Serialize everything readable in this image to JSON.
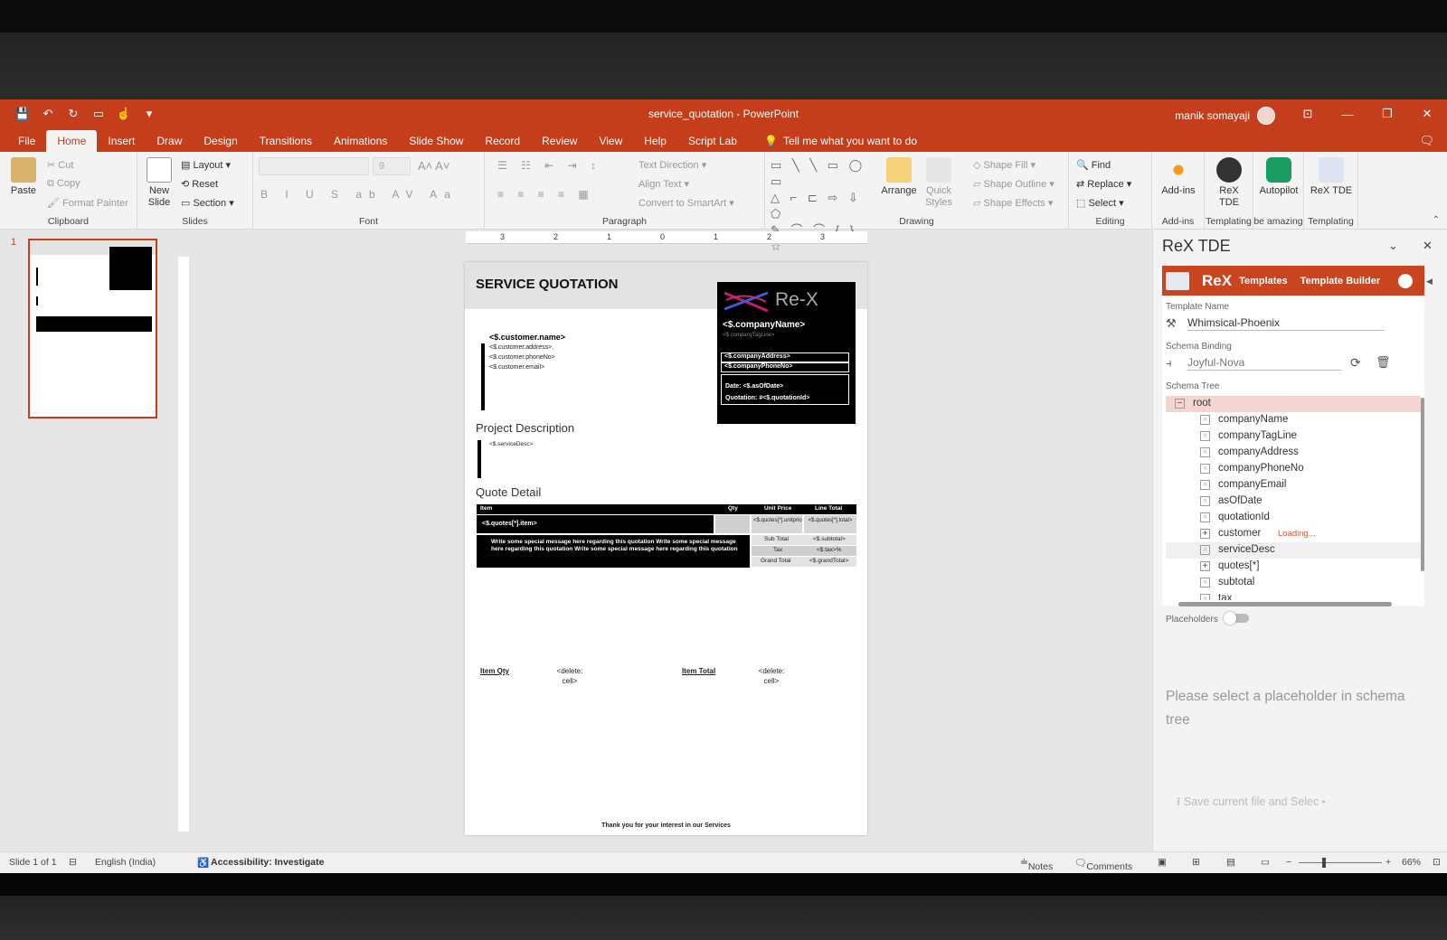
{
  "window": {
    "title": "service_quotation  -  PowerPoint",
    "user": "manik somayaji"
  },
  "tabs": [
    "File",
    "Home",
    "Insert",
    "Draw",
    "Design",
    "Transitions",
    "Animations",
    "Slide Show",
    "Record",
    "Review",
    "View",
    "Help",
    "Script Lab"
  ],
  "tell_me": "Tell me what you want to do",
  "clipboard": {
    "paste": "Paste",
    "cut": "Cut",
    "copy": "Copy",
    "format_painter": "Format Painter",
    "label": "Clipboard"
  },
  "slides_group": {
    "new_slide": "New Slide",
    "layout": "Layout",
    "reset": "Reset",
    "section": "Section",
    "label": "Slides"
  },
  "font_group": {
    "size": "9",
    "label": "Font"
  },
  "paragraph_group": {
    "text_direction": "Text Direction",
    "align_text": "Align Text",
    "smartart": "Convert to SmartArt",
    "label": "Paragraph"
  },
  "drawing_group": {
    "arrange": "Arrange",
    "quick_styles": "Quick Styles",
    "fill": "Shape Fill",
    "outline": "Shape Outline",
    "effects": "Shape Effects",
    "label": "Drawing"
  },
  "editing_group": {
    "find": "Find",
    "replace": "Replace",
    "select": "Select",
    "label": "Editing"
  },
  "addins_group": {
    "addins": "Add-ins",
    "label": "Add-ins"
  },
  "rex_group": {
    "btn1": "ReX TDE",
    "label1": "Templating",
    "autopilot": "Autopilot",
    "label2": "be amazing",
    "btn3": "ReX TDE",
    "label3": "Templating"
  },
  "thumb_number": "1",
  "slide": {
    "title": "SERVICE QUOTATION",
    "logo": "Re-X",
    "company_name": "<$.companyName>",
    "tagline": "<$.companyTagLine>",
    "company_address": "<$.companyAddress>",
    "company_phone": "<$.companyPhoneNo>",
    "date": "Date: <$.asOfDate>",
    "quotation": "Quotation: #<$.quotationId>",
    "customer_name": "<$.customer.name>",
    "customer_address": "<$.customer.address>,",
    "customer_phone": "<$.customer.phoneNo>",
    "customer_email": "<$.customer.email>",
    "project_heading": "Project Description",
    "service_desc": "<$.serviceDesc>",
    "quote_heading": "Quote Detail",
    "table_headers": [
      "Item",
      "Qty",
      "Unit Price",
      "Line Total"
    ],
    "item_cell": "<$.quotes[*].item>",
    "unit_price_cell": "<$.quotes[*].unitprice>",
    "line_total_cell": "<$.quotes[*].total>",
    "message": "Write some special message here regarding this quotation Write some special message here regarding this quotation Write some special message here regarding this quotation",
    "subtotal_label": "Sub Total",
    "subtotal_val": "<$.subtotal>",
    "tax_label": "Tax",
    "tax_val": "<$.tax>%",
    "grand_label": "Grand Total",
    "grand_val": "<$.grandTotal>",
    "item_qty": "Item Qty",
    "delete_cell1": "<delete: cell>",
    "item_total": "Item Total",
    "delete_cell2": "<delete: cell>",
    "footer": "Thank you for your interest in our Services"
  },
  "pane": {
    "title": "ReX TDE",
    "rex_brand": "ReX",
    "templates": "Templates",
    "builder": "Template Builder",
    "template_name_label": "Template Name",
    "template_name": "Whimsical-Phoenix",
    "schema_label": "Schema Binding",
    "schema_placeholder": "Joyful-Nova",
    "tree_label": "Schema Tree",
    "tree": [
      "root",
      "companyName",
      "companyTagLine",
      "companyAddress",
      "companyPhoneNo",
      "companyEmail",
      "asOfDate",
      "quotationId",
      "customer",
      "serviceDesc",
      "quotes[*]",
      "subtotal",
      "tax"
    ],
    "loading": "Loading...",
    "placeholders_label": "Placeholders",
    "hint": "Please select a placeholder in schema tree",
    "save": "Save current file and Selec"
  },
  "status": {
    "slide": "Slide 1 of 1",
    "language": "English (India)",
    "accessibility": "Accessibility: Investigate",
    "notes": "Notes",
    "comments": "Comments",
    "zoom": "66%"
  }
}
